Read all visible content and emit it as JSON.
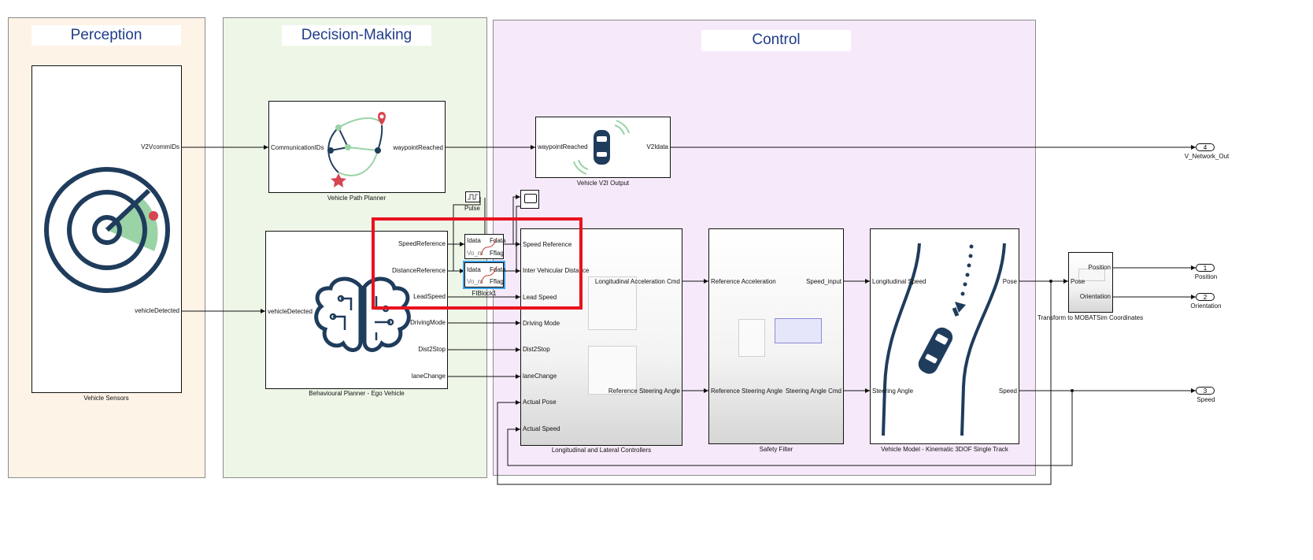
{
  "areas": {
    "perception": "Perception",
    "decision": "Decision-Making",
    "control": "Control"
  },
  "blocks": {
    "sensors": {
      "name": "Vehicle Sensors",
      "out_v2v": "V2VcommIDs",
      "out_vehicle": "vehicleDetected"
    },
    "path_planner": {
      "name": "Vehicle Path Planner",
      "in_comm": "CommunicationIDs",
      "out_wp": "waypointReached"
    },
    "v2i": {
      "name": "Vehicle V2I Output",
      "in_wp": "waypointReached",
      "out": "V2Idata"
    },
    "behav": {
      "name": "Behavioural Planner - Ego Vehicle",
      "in_vehicle": "vehicleDetected",
      "outs": [
        "SpeedReference",
        "DistanceReference",
        "LeadSpeed",
        "DrivingMode",
        "Dist2Stop",
        "laneChange"
      ]
    },
    "controllers": {
      "name": "Longitudinal and Lateral Controllers",
      "ins": [
        "Speed Reference",
        "Inter Vehicular Distance",
        "Lead Speed",
        "Driving Mode",
        "Dist2Stop",
        "laneChange",
        "Actual Pose",
        "Actual Speed"
      ],
      "out_accel": "Longitudinal Acceleration Cmd",
      "out_steer": "Reference Steering Angle"
    },
    "safety": {
      "name": "Safety Filter",
      "in_accel": "Reference Acceleration",
      "in_steer": "Reference Steering Angle",
      "out_speed": "Speed_input",
      "out_steer": "Steering Angle Cmd"
    },
    "vehicle_model": {
      "name": "Vehicle Model - Kinematic 3DOF Single Track",
      "in_speed": "Longitudinal Speed",
      "in_steer": "Steering Angle",
      "out_pose": "Pose",
      "out_speed": "Speed"
    },
    "transform": {
      "name": "Transform to MOBATSim Coordinates",
      "in": "Pose",
      "out_pos": "Position",
      "out_orient": "Orientation"
    },
    "pulse": {
      "name": "Pulse"
    },
    "fiblock": {
      "name": "FIBlock1",
      "in": "Idata",
      "out_data": "Fdata",
      "out_flag": "Fflag",
      "sub": "Vo_m"
    }
  },
  "outports": [
    {
      "num": "4",
      "name": "V_Network_Out"
    },
    {
      "num": "1",
      "name": "Position"
    },
    {
      "num": "2",
      "name": "Orientation"
    },
    {
      "num": "3",
      "name": "Speed"
    }
  ],
  "colors": {
    "perception_bg": "#fdf3e6",
    "decision_bg": "#eef6e8",
    "control_bg": "#f6eafa",
    "highlight": "#e8121e",
    "icon_navy": "#1f3c5c",
    "icon_green": "#9ad3a6",
    "icon_red": "#d64550"
  }
}
